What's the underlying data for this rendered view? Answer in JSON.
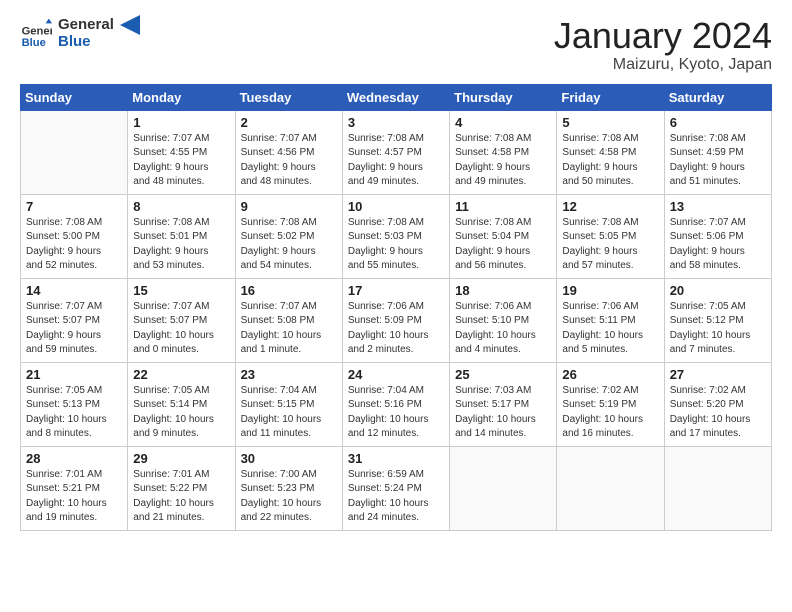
{
  "header": {
    "logo_general": "General",
    "logo_blue": "Blue",
    "title": "January 2024",
    "subtitle": "Maizuru, Kyoto, Japan"
  },
  "days_of_week": [
    "Sunday",
    "Monday",
    "Tuesday",
    "Wednesday",
    "Thursday",
    "Friday",
    "Saturday"
  ],
  "weeks": [
    [
      {
        "day": "",
        "info": ""
      },
      {
        "day": "1",
        "info": "Sunrise: 7:07 AM\nSunset: 4:55 PM\nDaylight: 9 hours\nand 48 minutes."
      },
      {
        "day": "2",
        "info": "Sunrise: 7:07 AM\nSunset: 4:56 PM\nDaylight: 9 hours\nand 48 minutes."
      },
      {
        "day": "3",
        "info": "Sunrise: 7:08 AM\nSunset: 4:57 PM\nDaylight: 9 hours\nand 49 minutes."
      },
      {
        "day": "4",
        "info": "Sunrise: 7:08 AM\nSunset: 4:58 PM\nDaylight: 9 hours\nand 49 minutes."
      },
      {
        "day": "5",
        "info": "Sunrise: 7:08 AM\nSunset: 4:58 PM\nDaylight: 9 hours\nand 50 minutes."
      },
      {
        "day": "6",
        "info": "Sunrise: 7:08 AM\nSunset: 4:59 PM\nDaylight: 9 hours\nand 51 minutes."
      }
    ],
    [
      {
        "day": "7",
        "info": "Sunrise: 7:08 AM\nSunset: 5:00 PM\nDaylight: 9 hours\nand 52 minutes."
      },
      {
        "day": "8",
        "info": "Sunrise: 7:08 AM\nSunset: 5:01 PM\nDaylight: 9 hours\nand 53 minutes."
      },
      {
        "day": "9",
        "info": "Sunrise: 7:08 AM\nSunset: 5:02 PM\nDaylight: 9 hours\nand 54 minutes."
      },
      {
        "day": "10",
        "info": "Sunrise: 7:08 AM\nSunset: 5:03 PM\nDaylight: 9 hours\nand 55 minutes."
      },
      {
        "day": "11",
        "info": "Sunrise: 7:08 AM\nSunset: 5:04 PM\nDaylight: 9 hours\nand 56 minutes."
      },
      {
        "day": "12",
        "info": "Sunrise: 7:08 AM\nSunset: 5:05 PM\nDaylight: 9 hours\nand 57 minutes."
      },
      {
        "day": "13",
        "info": "Sunrise: 7:07 AM\nSunset: 5:06 PM\nDaylight: 9 hours\nand 58 minutes."
      }
    ],
    [
      {
        "day": "14",
        "info": "Sunrise: 7:07 AM\nSunset: 5:07 PM\nDaylight: 9 hours\nand 59 minutes."
      },
      {
        "day": "15",
        "info": "Sunrise: 7:07 AM\nSunset: 5:07 PM\nDaylight: 10 hours\nand 0 minutes."
      },
      {
        "day": "16",
        "info": "Sunrise: 7:07 AM\nSunset: 5:08 PM\nDaylight: 10 hours\nand 1 minute."
      },
      {
        "day": "17",
        "info": "Sunrise: 7:06 AM\nSunset: 5:09 PM\nDaylight: 10 hours\nand 2 minutes."
      },
      {
        "day": "18",
        "info": "Sunrise: 7:06 AM\nSunset: 5:10 PM\nDaylight: 10 hours\nand 4 minutes."
      },
      {
        "day": "19",
        "info": "Sunrise: 7:06 AM\nSunset: 5:11 PM\nDaylight: 10 hours\nand 5 minutes."
      },
      {
        "day": "20",
        "info": "Sunrise: 7:05 AM\nSunset: 5:12 PM\nDaylight: 10 hours\nand 7 minutes."
      }
    ],
    [
      {
        "day": "21",
        "info": "Sunrise: 7:05 AM\nSunset: 5:13 PM\nDaylight: 10 hours\nand 8 minutes."
      },
      {
        "day": "22",
        "info": "Sunrise: 7:05 AM\nSunset: 5:14 PM\nDaylight: 10 hours\nand 9 minutes."
      },
      {
        "day": "23",
        "info": "Sunrise: 7:04 AM\nSunset: 5:15 PM\nDaylight: 10 hours\nand 11 minutes."
      },
      {
        "day": "24",
        "info": "Sunrise: 7:04 AM\nSunset: 5:16 PM\nDaylight: 10 hours\nand 12 minutes."
      },
      {
        "day": "25",
        "info": "Sunrise: 7:03 AM\nSunset: 5:17 PM\nDaylight: 10 hours\nand 14 minutes."
      },
      {
        "day": "26",
        "info": "Sunrise: 7:02 AM\nSunset: 5:19 PM\nDaylight: 10 hours\nand 16 minutes."
      },
      {
        "day": "27",
        "info": "Sunrise: 7:02 AM\nSunset: 5:20 PM\nDaylight: 10 hours\nand 17 minutes."
      }
    ],
    [
      {
        "day": "28",
        "info": "Sunrise: 7:01 AM\nSunset: 5:21 PM\nDaylight: 10 hours\nand 19 minutes."
      },
      {
        "day": "29",
        "info": "Sunrise: 7:01 AM\nSunset: 5:22 PM\nDaylight: 10 hours\nand 21 minutes."
      },
      {
        "day": "30",
        "info": "Sunrise: 7:00 AM\nSunset: 5:23 PM\nDaylight: 10 hours\nand 22 minutes."
      },
      {
        "day": "31",
        "info": "Sunrise: 6:59 AM\nSunset: 5:24 PM\nDaylight: 10 hours\nand 24 minutes."
      },
      {
        "day": "",
        "info": ""
      },
      {
        "day": "",
        "info": ""
      },
      {
        "day": "",
        "info": ""
      }
    ]
  ]
}
